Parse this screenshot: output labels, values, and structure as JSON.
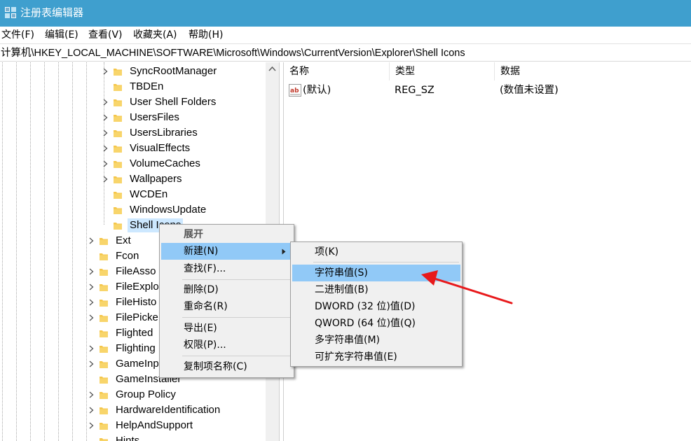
{
  "window": {
    "title": "注册表编辑器"
  },
  "menu": [
    "文件(F)",
    "编辑(E)",
    "查看(V)",
    "收藏夹(A)",
    "帮助(H)"
  ],
  "address": "计算机\\HKEY_LOCAL_MACHINE\\SOFTWARE\\Microsoft\\Windows\\CurrentVersion\\Explorer\\Shell Icons",
  "tree": {
    "inner": [
      "SyncRootManager",
      "TBDEn",
      "User Shell Folders",
      "UsersFiles",
      "UsersLibraries",
      "VisualEffects",
      "VolumeCaches",
      "Wallpapers",
      "WCDEn",
      "WindowsUpdate",
      "Shell Icons"
    ],
    "outer": [
      "Ext",
      "Fcon",
      "FileAsso",
      "FileExplo",
      "FileHisto",
      "FilePicke",
      "Flighted",
      "Flighting",
      "GameInp",
      "GameInstaller",
      "Group Policy",
      "HardwareIdentification",
      "HelpAndSupport",
      "Hints"
    ]
  },
  "list": {
    "headers": {
      "name": "名称",
      "type": "类型",
      "data": "数据"
    },
    "rows": [
      {
        "name": "(默认)",
        "type": "REG_SZ",
        "data": "(数值未设置)"
      }
    ]
  },
  "context_menu": {
    "items": [
      "展开",
      "新建(N)",
      "查找(F)...",
      "删除(D)",
      "重命名(R)",
      "导出(E)",
      "权限(P)...",
      "复制项名称(C)"
    ]
  },
  "submenu": {
    "items": [
      "项(K)",
      "字符串值(S)",
      "二进制值(B)",
      "DWORD (32 位)值(D)",
      "QWORD (64 位)值(Q)",
      "多字符串值(M)",
      "可扩充字符串值(E)"
    ]
  },
  "colors": {
    "titlebar": "#3f9fce",
    "highlight": "#91c9f7",
    "annotation": "#e8191b"
  }
}
